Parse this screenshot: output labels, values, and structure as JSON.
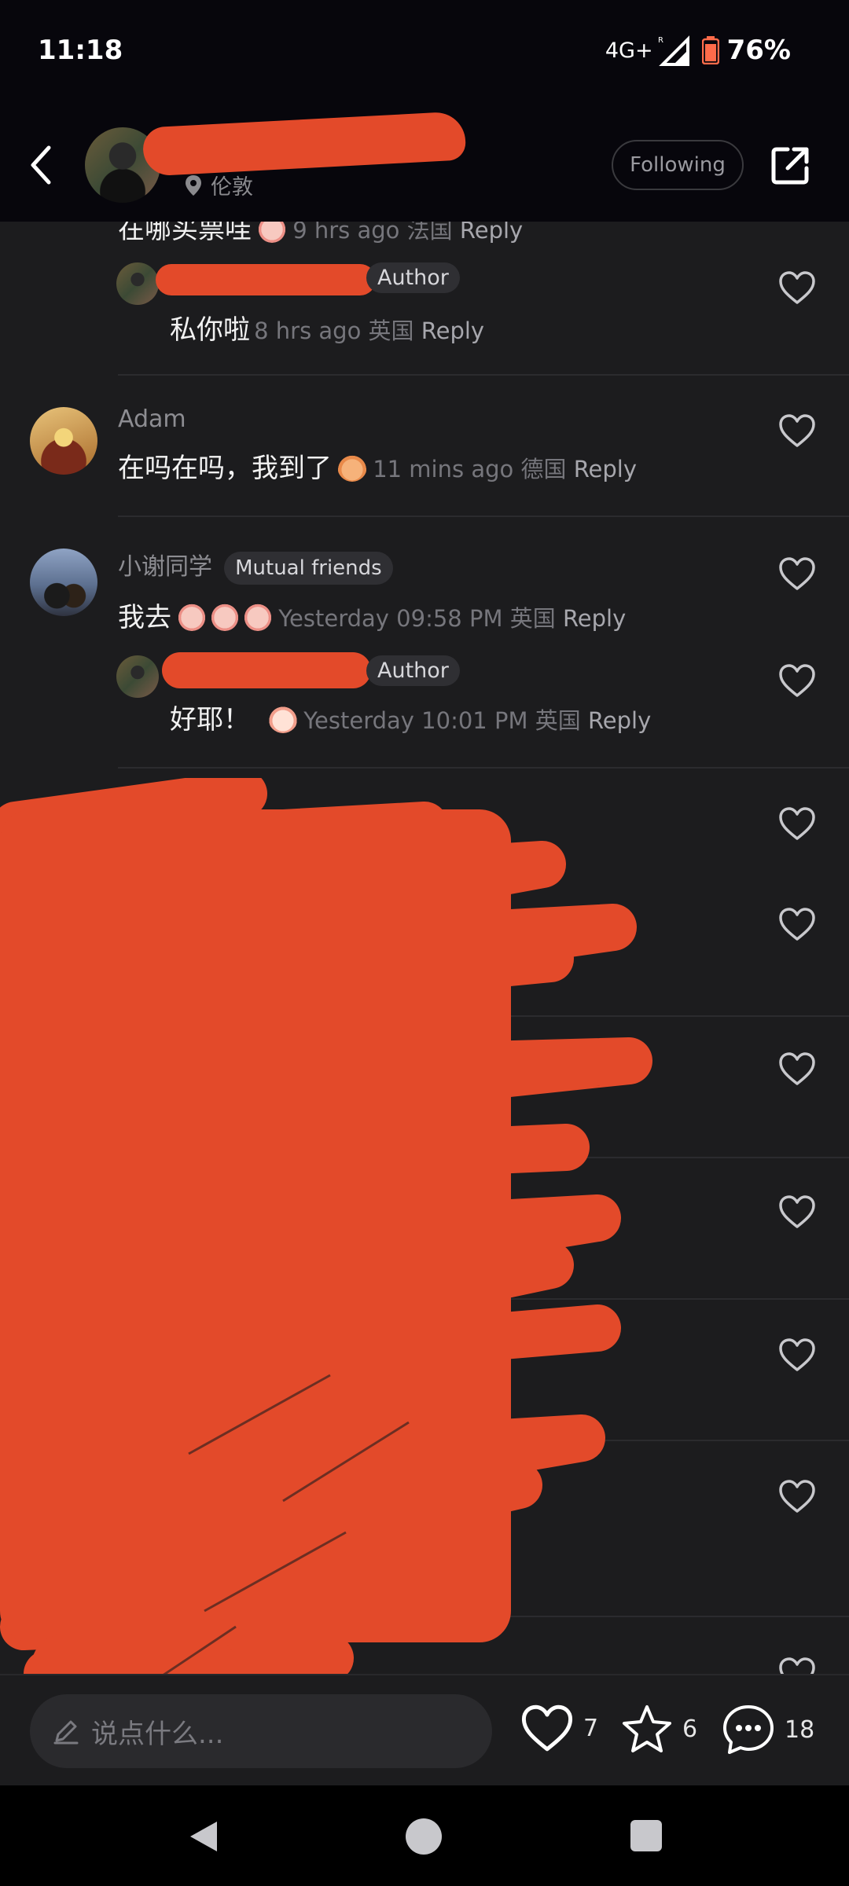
{
  "status_bar": {
    "time": "11:18",
    "network": "4G+",
    "battery": "76%"
  },
  "header": {
    "location": "伦敦",
    "following_label": "Following"
  },
  "comments": {
    "partial_top": {
      "text": "在哪买票哇",
      "time": "9 hrs ago",
      "region": "法国",
      "reply": "Reply"
    },
    "reply_author_1": {
      "badge": "Author",
      "text": "私你啦",
      "time": "8 hrs ago",
      "region": "英国",
      "reply": "Reply"
    },
    "adam": {
      "username": "Adam",
      "text": "在吗在吗，我到了",
      "time": "11 mins ago",
      "region": "德国",
      "reply": "Reply"
    },
    "xie": {
      "username": "小谢同学",
      "badge": "Mutual friends",
      "text": "我去",
      "time": "Yesterday 09:58 PM",
      "region": "英国",
      "reply": "Reply"
    },
    "reply_author_2": {
      "badge": "Author",
      "text": "好耶！",
      "time": "Yesterday 10:01 PM",
      "region": "英国",
      "reply": "Reply"
    }
  },
  "bottom_bar": {
    "input_placeholder": "说点什么...",
    "likes": "7",
    "favorites": "6",
    "comments": "18"
  },
  "colors": {
    "redaction": "#e34a2a",
    "background": "#1c1c1e",
    "header_bg": "#07060c"
  },
  "icons": [
    "back-icon",
    "location-pin-icon",
    "share-icon",
    "heart-icon",
    "pencil-icon",
    "star-icon",
    "comment-bubble-icon"
  ]
}
